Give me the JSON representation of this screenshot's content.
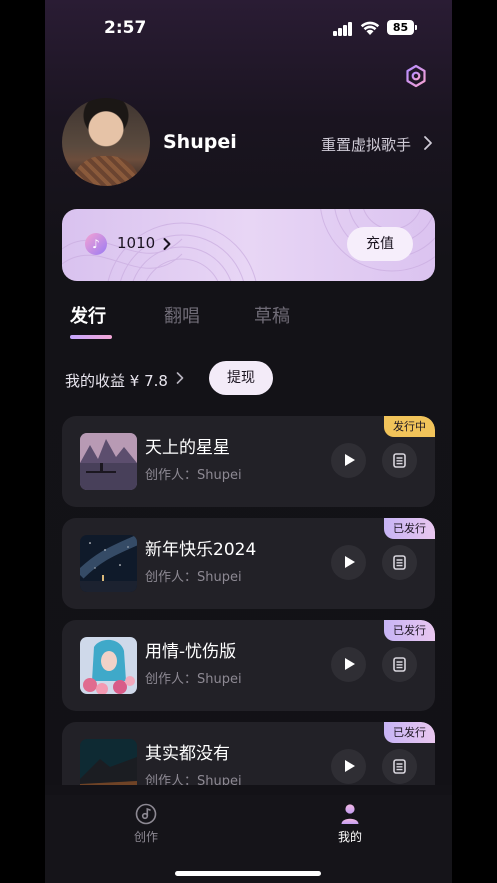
{
  "status_bar": {
    "time": "2:57",
    "battery": "85"
  },
  "profile": {
    "username": "Shupei",
    "reset_link": "重置虚拟歌手"
  },
  "coin_card": {
    "amount": "1010",
    "recharge_label": "充值"
  },
  "tabs": [
    {
      "label": "发行",
      "active": true
    },
    {
      "label": "翻唱",
      "active": false
    },
    {
      "label": "草稿",
      "active": false
    }
  ],
  "earnings": {
    "label": "我的收益 ¥ 7.8",
    "withdraw_label": "提现"
  },
  "songs": [
    {
      "title": "天上的星星",
      "creator": "创作人：Shupei",
      "badge": "发行中",
      "status": "active"
    },
    {
      "title": "新年快乐2024",
      "creator": "创作人：Shupei",
      "badge": "已发行",
      "status": "done"
    },
    {
      "title": "用情-忧伤版",
      "creator": "创作人：Shupei",
      "badge": "已发行",
      "status": "done"
    },
    {
      "title": "其实都没有",
      "creator": "创作人：Shupei",
      "badge": "已发行",
      "status": "done"
    }
  ],
  "bottom_nav": [
    {
      "label": "创作",
      "active": false,
      "icon": "music-disc-icon"
    },
    {
      "label": "我的",
      "active": true,
      "icon": "person-icon"
    }
  ],
  "colors": {
    "accent_gold": "#f1c35a",
    "accent_lilac": "#c7b4f5",
    "card_bg": "#222127"
  }
}
